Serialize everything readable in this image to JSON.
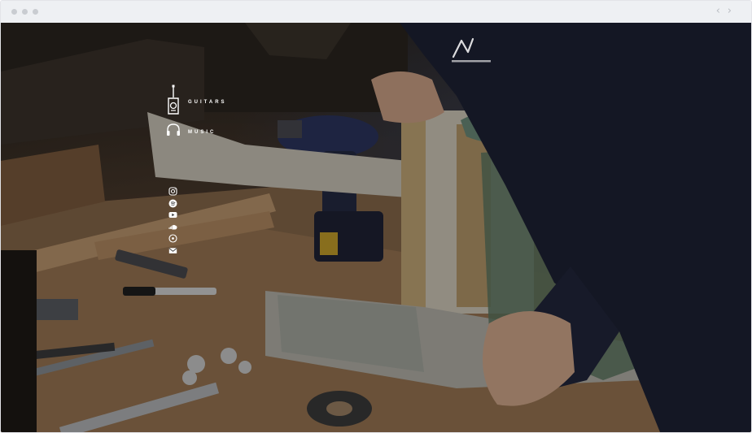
{
  "browser": {
    "back_icon": "chevron-left-icon",
    "forward_icon": "chevron-right-icon",
    "back_glyph": "‹",
    "forward_glyph": "›"
  },
  "hero": {
    "background_description_colors": {
      "overlay": "#000000",
      "wood": "#b08a62",
      "guitar_body": "#d9d4c8",
      "jacket": "#1e2235"
    }
  },
  "nav": {
    "items": [
      {
        "label": "GUITARS",
        "icon": "guitar-icon"
      },
      {
        "label": "MUSIC",
        "icon": "headphones-icon"
      }
    ]
  },
  "social": {
    "items": [
      {
        "icon": "instagram-icon"
      },
      {
        "icon": "spotify-icon"
      },
      {
        "icon": "youtube-icon"
      },
      {
        "icon": "soundcloud-icon"
      },
      {
        "icon": "music-disc-icon"
      },
      {
        "icon": "email-icon"
      }
    ]
  }
}
